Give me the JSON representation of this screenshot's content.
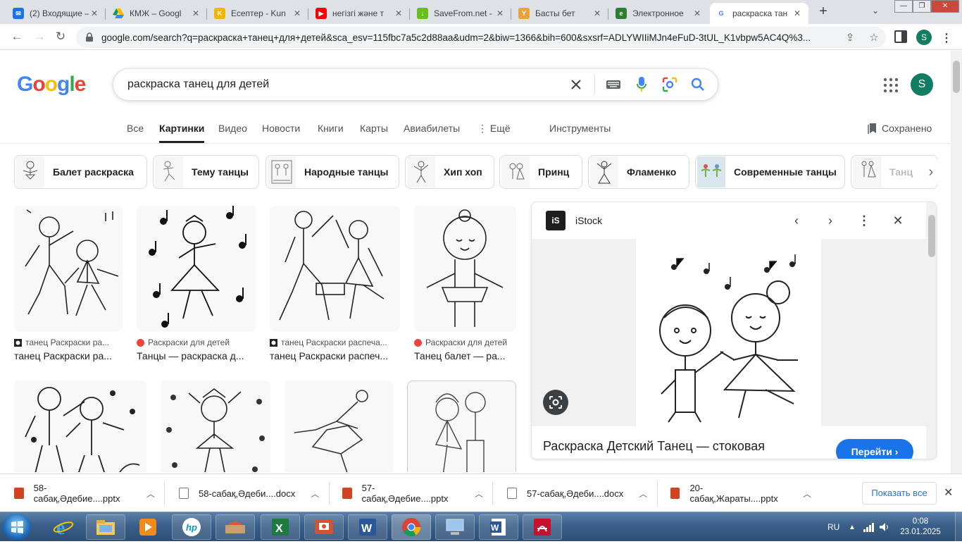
{
  "browser": {
    "tabs": [
      {
        "label": "(2) Входящие –",
        "favicon": "mail-icon",
        "color": "#1a73e8"
      },
      {
        "label": "КМЖ – Googl",
        "favicon": "drive-icon",
        "color": "#0f9d58"
      },
      {
        "label": "Есептер - Kun",
        "favicon": "kundelik-icon",
        "color": "#f4b400"
      },
      {
        "label": "негізгі және т",
        "favicon": "youtube-icon",
        "color": "#ff0000"
      },
      {
        "label": "SaveFrom.net -",
        "favicon": "savefrom-icon",
        "color": "#6abf1e"
      },
      {
        "label": "Басты бет",
        "favicon": "bilimal-icon",
        "color": "#e8a33b"
      },
      {
        "label": "Электронное",
        "favicon": "egov-icon",
        "color": "#2e7d32"
      },
      {
        "label": "раскраска тан",
        "favicon": "google-icon",
        "color": "#4285f4"
      }
    ],
    "url": "google.com/search?q=раскраска+танец+для+детей&sca_esv=115fbc7a5c2d88aa&udm=2&biw=1366&bih=600&sxsrf=ADLYWIIiMJn4eFuD-3tUL_K1vbpw5AC4Q%3...",
    "profile_initial": "S"
  },
  "search": {
    "logo": [
      "G",
      "o",
      "o",
      "g",
      "l",
      "e"
    ],
    "logo_colors": [
      "#4285f4",
      "#ea4335",
      "#fbbc05",
      "#4285f4",
      "#34a853",
      "#ea4335"
    ],
    "query": "раскраска танец для детей",
    "avatar_initial": "S"
  },
  "nav": {
    "tabs": [
      "Все",
      "Картинки",
      "Видео",
      "Новости",
      "Книги",
      "Карты",
      "Авиабилеты",
      "⋮ Ещё"
    ],
    "active": "Картинки",
    "tools": "Инструменты",
    "saved": "Сохранено"
  },
  "chips": [
    "Балет раскраска",
    "Тему танцы",
    "Народные танцы",
    "Хип хоп",
    "Принц",
    "Фламенко",
    "Современные танцы",
    "Танц"
  ],
  "results": [
    {
      "source": "танец Раскраски ра...",
      "title": "танец Раскраски ра..."
    },
    {
      "source": "Раскраски для детей",
      "title": "Танцы — раскраска д..."
    },
    {
      "source": "танец Раскраски распеча...",
      "title": "танец Раскраски распеч..."
    },
    {
      "source": "Раскраски для детей",
      "title": "Танец балет — ра..."
    }
  ],
  "panel": {
    "site": "iStock",
    "title": "Раскраска Детский Танец — стоковая",
    "go_label": "Перейти ›"
  },
  "downloads": {
    "items": [
      {
        "name": "58-сабақ,Әдебие....pptx",
        "type": "pptx"
      },
      {
        "name": "58-сабақ,Әдеби....docx",
        "type": "docx"
      },
      {
        "name": "57-сабақ,Әдебие....pptx",
        "type": "pptx"
      },
      {
        "name": "57-сабақ,Әдеби....docx",
        "type": "docx"
      },
      {
        "name": "20-сабақ,Жараты....pptx",
        "type": "pptx"
      }
    ],
    "show_all": "Показать все"
  },
  "taskbar": {
    "lang": "RU",
    "time": "0:08",
    "date": "23.01.2025"
  }
}
